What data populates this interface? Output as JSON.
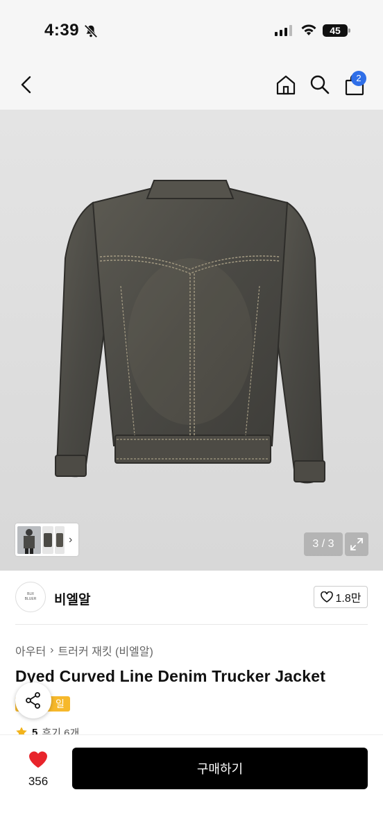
{
  "status_bar": {
    "time": "4:39",
    "battery": "45"
  },
  "nav": {
    "cart_count": "2"
  },
  "gallery": {
    "page_indicator": "3 / 3"
  },
  "brand": {
    "logo_line1": "BLR",
    "logo_line2": "BLUER",
    "name": "비엘알",
    "likes": "1.8만"
  },
  "product": {
    "breadcrumb": [
      "아우터",
      "트러커 재킷 (비엘알)"
    ],
    "title": "Dyed Curved Line Denim Trucker Jacket",
    "tag": "일",
    "rating": "5",
    "reviews": "후기 6개"
  },
  "bottom": {
    "wish_count": "356",
    "buy_label": "구매하기"
  },
  "colors": {
    "accent_blue": "#2f6fe8",
    "heart_red": "#e8242b",
    "tag_yellow": "#f6b82b",
    "star_yellow": "#f2b31c"
  }
}
